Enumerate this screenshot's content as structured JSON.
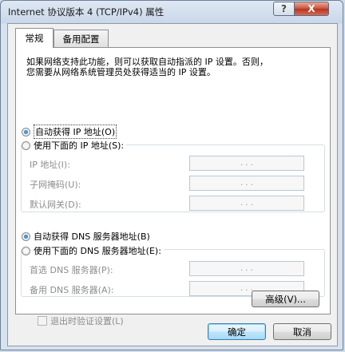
{
  "window": {
    "title": "Internet 协议版本 4 (TCP/IPv4) 属性",
    "help_label": "?",
    "close_label": "X"
  },
  "tabs": [
    {
      "label": "常规"
    },
    {
      "label": "备用配置"
    }
  ],
  "description": {
    "line1": "如果网络支持此功能，则可以获取自动指派的 IP 设置。否则，",
    "line2": "您需要从网络系统管理员处获得适当的 IP 设置。"
  },
  "ip_section": {
    "auto_label": "自动获得 IP 地址(O)",
    "manual_label": "使用下面的 IP 地址(S):",
    "selected": "auto",
    "fields": [
      {
        "label": "IP 地址(I):",
        "value": ". . ."
      },
      {
        "label": "子网掩码(U):",
        "value": ". . ."
      },
      {
        "label": "默认网关(D):",
        "value": ". . ."
      }
    ]
  },
  "dns_section": {
    "auto_label": "自动获得 DNS 服务器地址(B)",
    "manual_label": "使用下面的 DNS 服务器地址(E):",
    "selected": "auto",
    "fields": [
      {
        "label": "首选 DNS 服务器(P):",
        "value": ". . ."
      },
      {
        "label": "备用 DNS 服务器(A):",
        "value": ". . ."
      }
    ]
  },
  "validate_checkbox": {
    "label": "退出时验证设置(L)",
    "checked": false
  },
  "buttons": {
    "advanced": "高级(V)...",
    "ok": "确定",
    "cancel": "取消"
  },
  "colors": {
    "title_gradient_top": "#dfe8f3",
    "close_button": "#c9503a",
    "default_button_border": "#3c7fb1"
  }
}
